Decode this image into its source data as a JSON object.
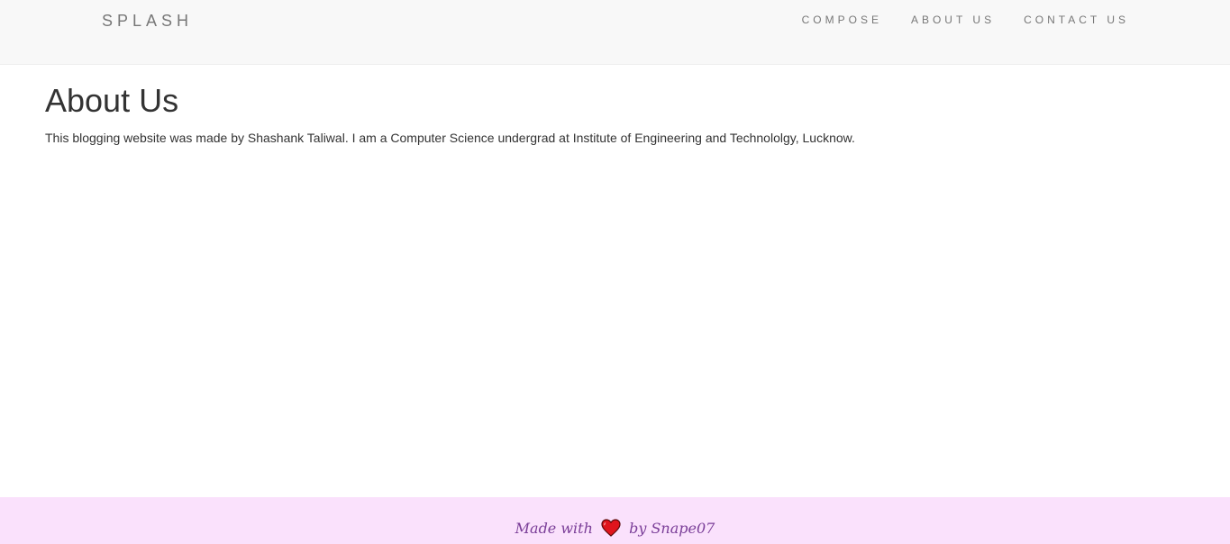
{
  "navbar": {
    "brand": "SPLASH",
    "links": [
      {
        "label": "COMPOSE"
      },
      {
        "label": "ABOUT US"
      },
      {
        "label": "CONTACT US"
      }
    ]
  },
  "main": {
    "title": "About Us",
    "text": "This blogging website was made by Shashank Taliwal. I am a Computer Science undergrad at Institute of Engineering and Technololgy, Lucknow."
  },
  "footer": {
    "prefix": "Made with",
    "icon": "heart-icon",
    "suffix": "by Snape07"
  },
  "colors": {
    "navbar_bg": "#f8f8f8",
    "footer_bg": "#fae1fc",
    "footer_text": "#7a3e98",
    "heart": "#e0151d"
  }
}
